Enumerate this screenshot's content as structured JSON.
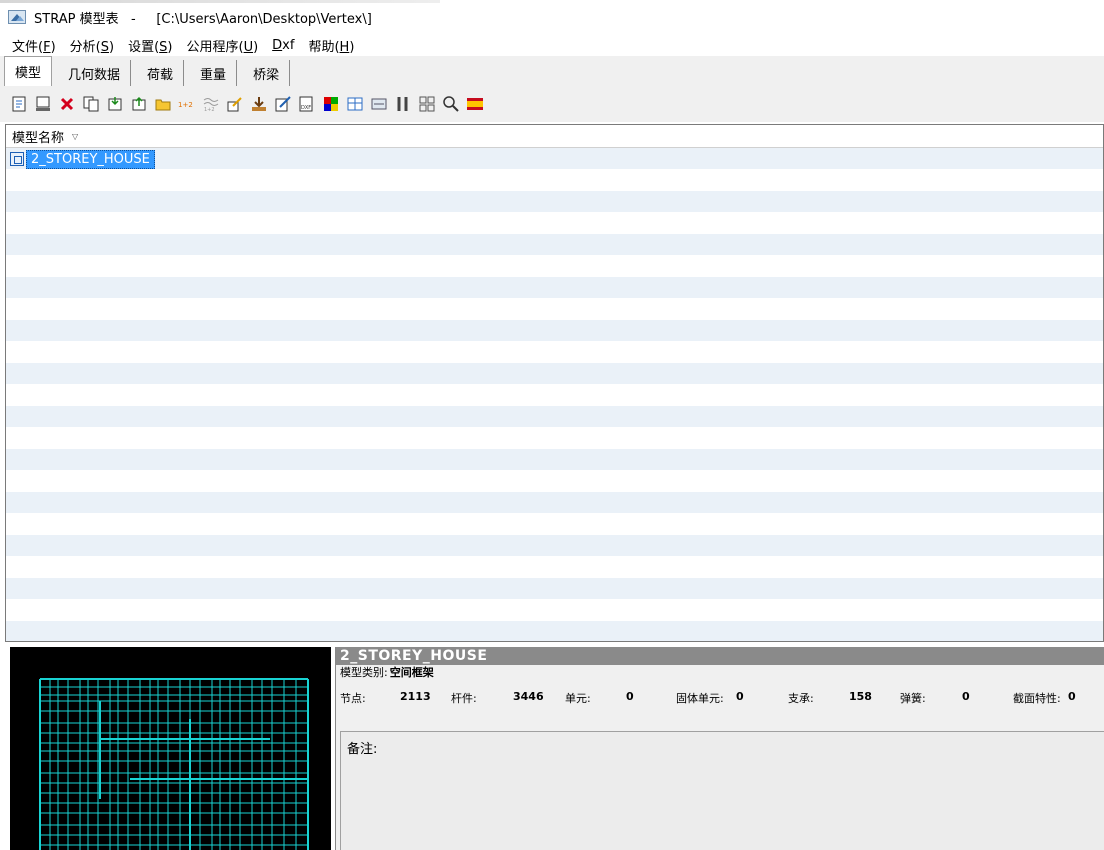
{
  "window": {
    "app": "STRAP 模型表",
    "separator": "-",
    "path": "[C:\\Users\\Aaron\\Desktop\\Vertex\\]"
  },
  "menu": [
    {
      "text": "文件(",
      "acc": "F",
      "end": ")"
    },
    {
      "text": "分析(",
      "acc": "S",
      "end": ")"
    },
    {
      "text": "设置(",
      "acc": "S",
      "end": ")"
    },
    {
      "text": "公用程序(",
      "acc": "U",
      "end": ")"
    },
    {
      "text": "",
      "acc": "D",
      "end": "xf"
    },
    {
      "text": "帮助(",
      "acc": "H",
      "end": ")"
    }
  ],
  "tabs": [
    "模型",
    "几何数据",
    "荷载",
    "重量",
    "桥梁"
  ],
  "toolbar_icons": [
    "new-model-icon",
    "model-properties-icon",
    "delete-icon",
    "copy-model-icon",
    "archive-icon",
    "restore-icon",
    "folder-icon",
    "renumber-icon",
    "combine-icon",
    "edit-icon",
    "import-icon",
    "edit-note-icon",
    "dxf-icon",
    "color-palette-icon",
    "layout-icon",
    "panel-icon",
    "tools-icon",
    "grid-icon",
    "search-icon",
    "language-flag-icon"
  ],
  "list": {
    "header": "模型名称",
    "selected": "2_STOREY_HOUSE"
  },
  "info": {
    "title": "2_STOREY_HOUSE",
    "type_label": "模型类别:",
    "type_value": "空间框架",
    "stats": [
      {
        "label": "节点:",
        "value": "2113"
      },
      {
        "label": "杆件:",
        "value": "3446"
      },
      {
        "label": "单元:",
        "value": "0"
      },
      {
        "label": "固体单元:",
        "value": "0"
      },
      {
        "label": "支承:",
        "value": "158"
      },
      {
        "label": "弹簧:",
        "value": "0"
      },
      {
        "label": "截面特性:",
        "value": "0"
      }
    ],
    "notes_label": "备注:"
  },
  "colors": {
    "selection": "#3399ff",
    "preview_lines": "#19d3d3",
    "stripe": "#eaf1f8"
  }
}
